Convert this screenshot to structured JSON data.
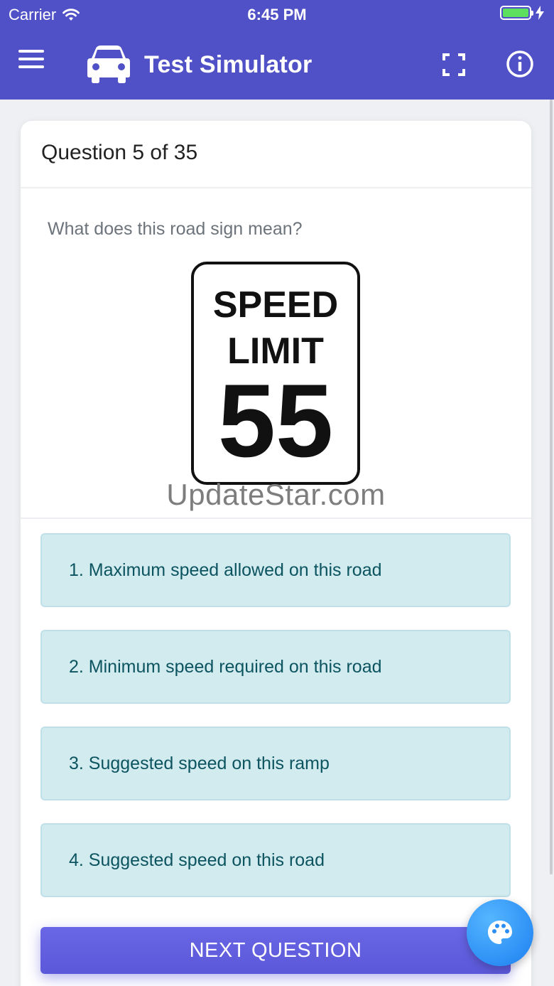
{
  "status_bar": {
    "carrier": "Carrier",
    "time": "6:45 PM",
    "battery_level": 1.0
  },
  "nav": {
    "title": "Test Simulator",
    "menu_icon": "hamburger-menu-icon",
    "app_icon": "car-icon",
    "fullscreen_icon": "fullscreen-icon",
    "info_icon": "info-icon",
    "background_color": "#5051c6"
  },
  "question": {
    "header": "Question 5 of 35",
    "prompt": "What does this road sign mean?",
    "sign": {
      "line1": "SPEED",
      "line2": "LIMIT",
      "number": "55"
    },
    "watermark": "UpdateStar.com"
  },
  "answers": [
    {
      "label": "1. Maximum speed allowed on this road"
    },
    {
      "label": "2. Minimum speed required on this road"
    },
    {
      "label": "3. Suggested speed on this ramp"
    },
    {
      "label": "4. Suggested speed on this road"
    }
  ],
  "actions": {
    "next_label": "NEXT QUESTION",
    "theme_icon": "palette-icon"
  },
  "colors": {
    "answer_bg": "#d2ebef",
    "answer_text": "#0c5460",
    "button": "#5b58d9",
    "fab": "#2b8ef5"
  }
}
